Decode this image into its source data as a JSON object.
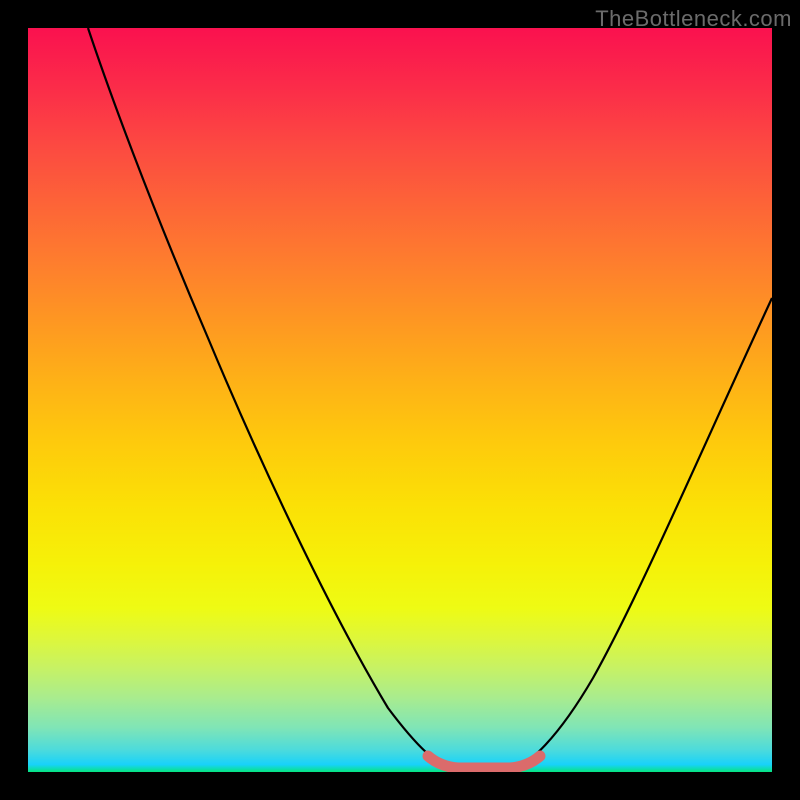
{
  "watermark": "TheBottleneck.com",
  "chart_data": {
    "type": "line",
    "title": "",
    "xlabel": "",
    "ylabel": "",
    "xlim": [
      0,
      100
    ],
    "ylim": [
      0,
      100
    ],
    "series": [
      {
        "name": "bottleneck-curve",
        "x": [
          8,
          15,
          25,
          35,
          45,
          52,
          56,
          60,
          64,
          68,
          75,
          85,
          95,
          100
        ],
        "y": [
          100,
          88,
          70,
          52,
          32,
          15,
          4,
          0,
          0,
          4,
          18,
          38,
          56,
          66
        ]
      }
    ],
    "highlight_region": {
      "x_start": 54,
      "x_end": 68,
      "description": "optimal-range",
      "color": "#e16666"
    },
    "gradient": {
      "top": "#fa114f",
      "mid": "#fecb0c",
      "bottom": "#06e57f"
    }
  }
}
